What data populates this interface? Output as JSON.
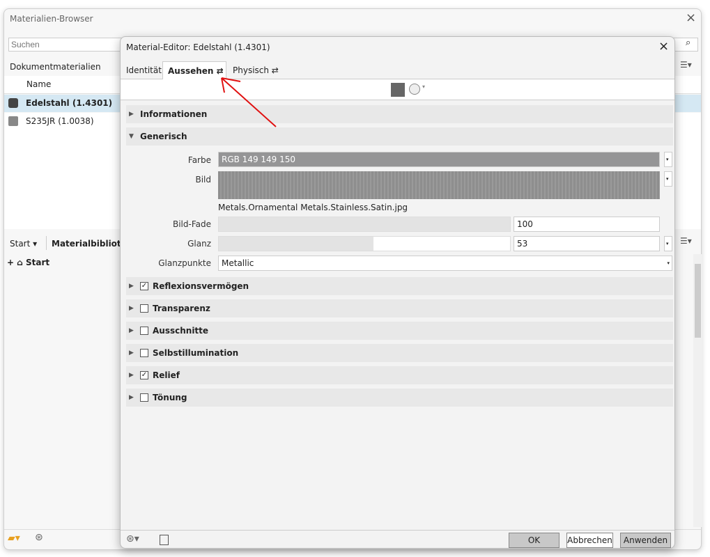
{
  "browser": {
    "title": "Materialien-Browser",
    "search_placeholder": "Suchen",
    "doc_materials": "Dokumentmaterialien",
    "col_name": "Name",
    "materials": [
      {
        "name": "Edelstahl (1.4301)",
        "selected": true
      },
      {
        "name": "S235JR (1.0038)",
        "selected": false
      }
    ],
    "start_dropdown": "Start",
    "library_label": "Materialbibliothek",
    "tree_start": "Start"
  },
  "editor": {
    "title": "Material-Editor: Edelstahl (1.4301)",
    "tabs": [
      {
        "label": "Identität"
      },
      {
        "label": "Aussehen",
        "active": true
      },
      {
        "label": "Physisch"
      }
    ],
    "sections_top": [
      {
        "label": "Informationen",
        "expanded": false
      },
      {
        "label": "Generisch",
        "expanded": true
      }
    ],
    "generic": {
      "farbe_label": "Farbe",
      "farbe_value": "RGB 149 149 150",
      "color": "#959596",
      "bild_label": "Bild",
      "bild_file": "Metals.Ornamental Metals.Stainless.Satin.jpg",
      "fade_label": "Bild-Fade",
      "fade_value": "100",
      "glanz_label": "Glanz",
      "glanz_value": "53",
      "glanzpunkte_label": "Glanzpunkte",
      "glanzpunkte_value": "Metallic"
    },
    "sections": [
      {
        "label": "Reflexionsvermögen",
        "checked": true
      },
      {
        "label": "Transparenz",
        "checked": false
      },
      {
        "label": "Ausschnitte",
        "checked": false
      },
      {
        "label": "Selbstillumination",
        "checked": false
      },
      {
        "label": "Relief",
        "checked": true
      },
      {
        "label": "Tönung",
        "checked": false
      }
    ],
    "ok": "OK",
    "cancel": "Abbrechen",
    "apply": "Anwenden"
  }
}
